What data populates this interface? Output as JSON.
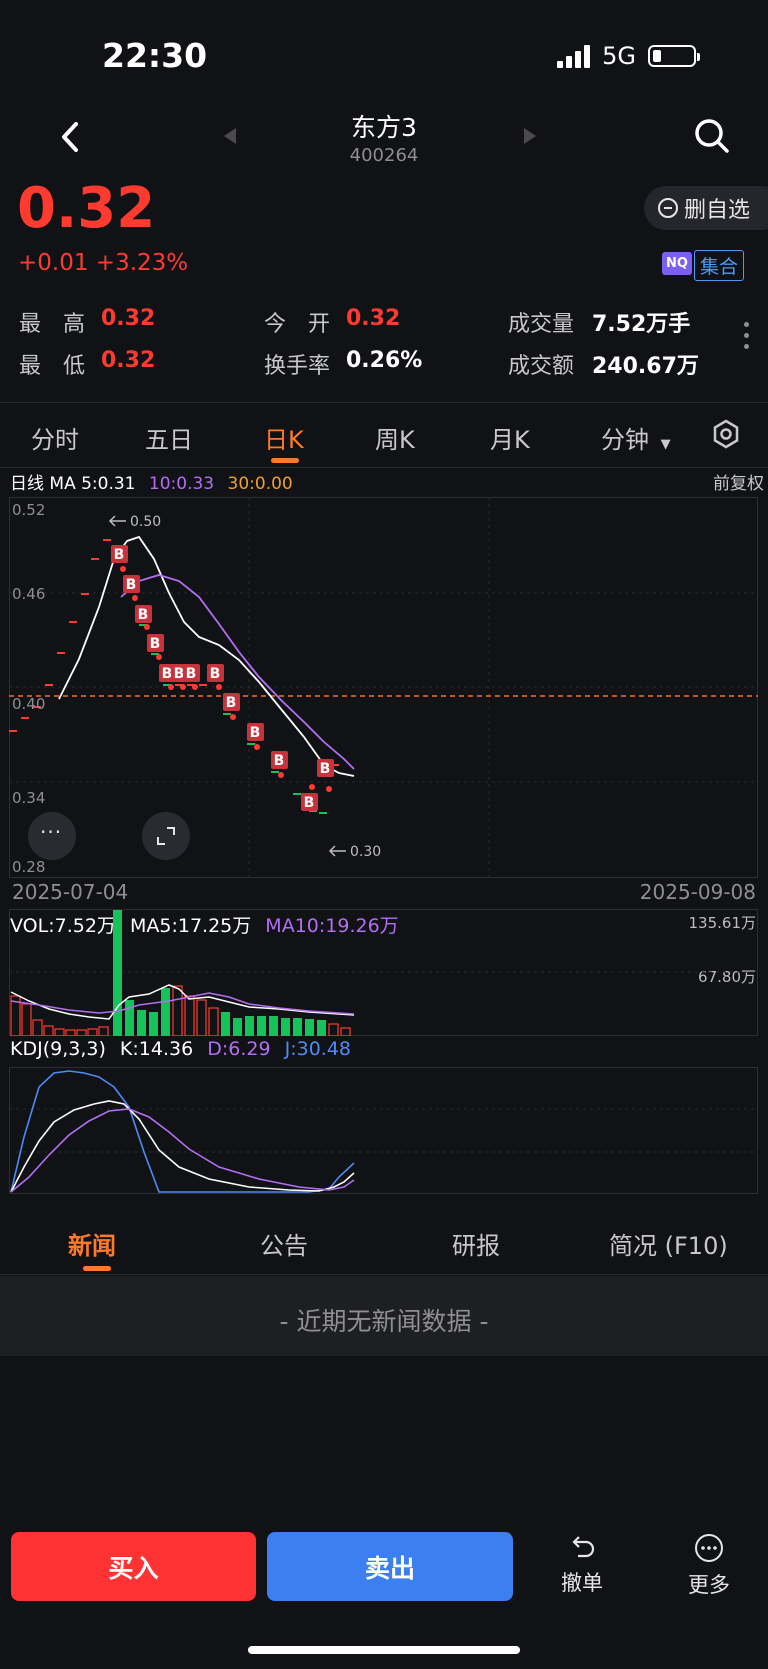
{
  "status": {
    "time": "22:30",
    "network": "5G"
  },
  "header": {
    "name": "东方3",
    "code": "400264"
  },
  "quote": {
    "price": "0.32",
    "change": "+0.01 +3.23%",
    "watch_label": "删自选",
    "badge_nq": "NQ",
    "badge_market": "集合"
  },
  "stats": [
    {
      "label": "最　高",
      "value": "0.32",
      "color": "red"
    },
    {
      "label": "今　开",
      "value": "0.32",
      "color": "red"
    },
    {
      "label": "成交量",
      "value": "7.52万手",
      "color": "white"
    },
    {
      "label": "最　低",
      "value": "0.32",
      "color": "red"
    },
    {
      "label": "换手率",
      "value": "0.26%",
      "color": "white"
    },
    {
      "label": "成交额",
      "value": "240.67万",
      "color": "white"
    }
  ],
  "tabs": [
    "分时",
    "五日",
    "日K",
    "周K",
    "月K",
    "分钟"
  ],
  "active_tab": "日K",
  "ma": {
    "prefix": "日线 MA 5:0.31",
    "ma10": "10:0.33",
    "ma30": "30:0.00",
    "adjust": "前复权"
  },
  "kline": {
    "y_labels": [
      "0.52",
      "0.46",
      "0.40",
      "0.34",
      "0.28"
    ],
    "date_start": "2025-07-04",
    "date_end": "2025-09-08",
    "high_marker": "0.50",
    "low_marker": "0.30",
    "signal_label": "B"
  },
  "volume": {
    "vol": "VOL:7.52万",
    "ma5": "MA5:17.25万",
    "ma10": "MA10:19.26万",
    "max": "135.61万",
    "mid": "67.80万"
  },
  "kdj": {
    "title": "KDJ(9,3,3)",
    "k": "K:14.36",
    "d": "D:6.29",
    "j": "J:30.48"
  },
  "news_tabs": [
    "新闻",
    "公告",
    "研报",
    "简况 (F10)"
  ],
  "news_empty": "- 近期无新闻数据 -",
  "bottom": {
    "buy": "买入",
    "sell": "卖出",
    "cancel": "撤单",
    "more": "更多"
  },
  "colors": {
    "up": "#ff3b30",
    "down": "#18c25a",
    "accent": "#ff7a28",
    "ma10": "#b36ef2",
    "ma30": "#f0a030",
    "j": "#4d8bf5"
  }
}
